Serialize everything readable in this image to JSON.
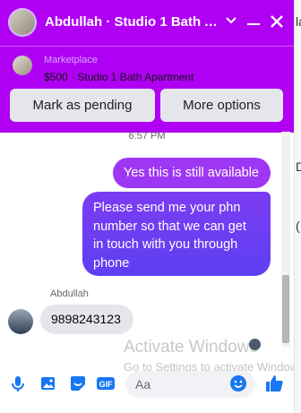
{
  "header": {
    "title": "Abdullah · Studio 1 Bath A...",
    "marketplace_label": "Marketplace",
    "listing": "$500 · Studio 1 Bath Apartment",
    "buttons": {
      "pending": "Mark as pending",
      "more": "More options"
    }
  },
  "conversation": {
    "timestamp": "6:57 PM",
    "messages": [
      {
        "from": "me",
        "text": "Yes this is still available"
      },
      {
        "from": "me",
        "text": "Please send me your phn number so that we can get in touch with you through phone"
      },
      {
        "from": "Abdullah",
        "sender_label": "Abdullah",
        "text": "9898243123"
      }
    ]
  },
  "watermark": {
    "line1": "Activate Windows",
    "line2": "Go to Settings to activate Windows."
  },
  "composer": {
    "placeholder": "Aa",
    "gif_label": "GIF"
  },
  "side": {
    "peek1": "la",
    "peek2": "D",
    "peek3": "("
  },
  "colors": {
    "header": "#b000f4",
    "bubble_out": "#9e37f3",
    "bubble_out_2": "#5e3ff2",
    "accent": "#1877f2"
  }
}
